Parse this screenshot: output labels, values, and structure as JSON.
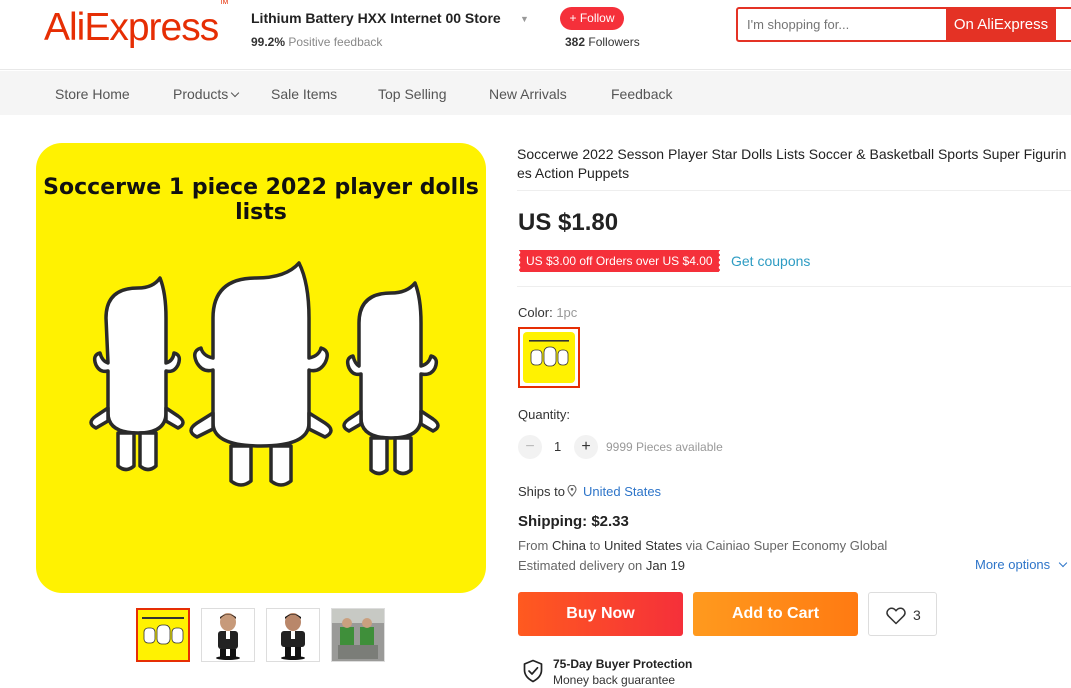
{
  "brand": {
    "logo": "AliExpress",
    "tm": "TM",
    "color": "#e62e04"
  },
  "store": {
    "name": "Lithium Battery HXX Internet 00 Store",
    "feedback_percent": "99.2%",
    "feedback_label": "Positive feedback",
    "follow_label": "+ Follow",
    "followers_count": "382",
    "followers_label": "Followers"
  },
  "search": {
    "placeholder": "I'm shopping for...",
    "scope": "On AliExpress"
  },
  "nav": [
    "Store Home",
    "Products",
    "Sale Items",
    "Top Selling",
    "New Arrivals",
    "Feedback"
  ],
  "gallery": {
    "main_image_text": "Soccerwe 1 piece 2022 player dolls lists",
    "thumbnails": [
      "player-dolls-lists",
      "player-figure-black-suit",
      "player-figure-black-suit-2",
      "player-figure-green-kit"
    ],
    "selected_index": 0
  },
  "product": {
    "title": "Soccerwe 2022 Sesson Player Star Dolls Lists Soccer & Basketball Sports Super Figurines Action Puppets",
    "price": "US $1.80",
    "coupon": "US $3.00 off Orders over US $4.00",
    "get_coupons": "Get coupons",
    "color_label": "Color:",
    "color_value": "1pc",
    "quantity_label": "Quantity:",
    "quantity_value": "1",
    "quantity_available": "9999 Pieces available",
    "minus": "−",
    "plus": "+"
  },
  "shipping": {
    "ships_to_label": "Ships to",
    "ships_to_country": "United States",
    "title": "Shipping: $2.33",
    "from_prefix": "From",
    "from_country": "China",
    "to_word": "to",
    "to_country": "United States",
    "via": "via Cainiao Super Economy Global",
    "delivery_prefix": "Estimated delivery on",
    "delivery_date": "Jan 19",
    "more_options": "More options"
  },
  "actions": {
    "buy_now": "Buy Now",
    "add_to_cart": "Add to Cart",
    "wishlist_count": "3"
  },
  "protection": {
    "title": "75-Day Buyer Protection",
    "subtitle": "Money back guarantee"
  }
}
